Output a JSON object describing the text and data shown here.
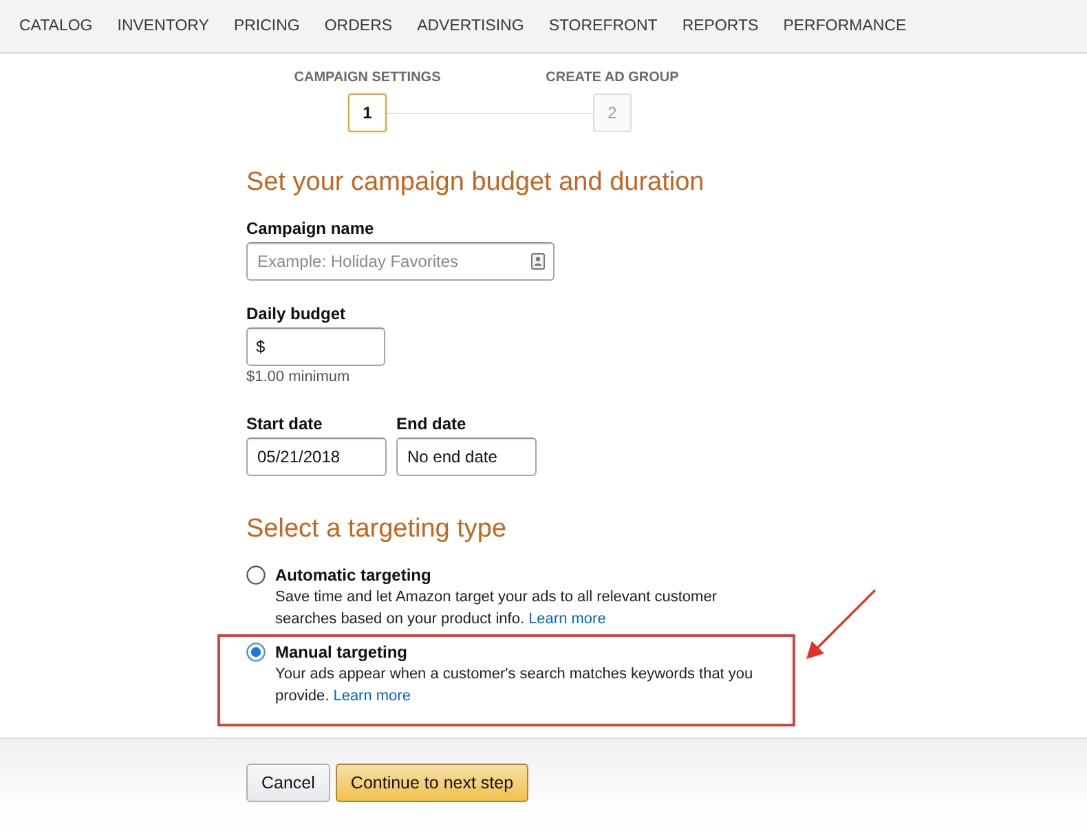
{
  "nav": {
    "items": [
      {
        "label": "CATALOG"
      },
      {
        "label": "INVENTORY"
      },
      {
        "label": "PRICING"
      },
      {
        "label": "ORDERS"
      },
      {
        "label": "ADVERTISING"
      },
      {
        "label": "STOREFRONT"
      },
      {
        "label": "REPORTS"
      },
      {
        "label": "PERFORMANCE"
      }
    ]
  },
  "stepper": {
    "steps": [
      {
        "label": "CAMPAIGN SETTINGS",
        "number": "1",
        "selected": true
      },
      {
        "label": "CREATE AD GROUP",
        "number": "2",
        "selected": false
      }
    ]
  },
  "budget_section": {
    "title": "Set your campaign budget and duration",
    "rows": [
      {
        "fields": [
          {
            "kind": "text",
            "label": "Campaign name",
            "placeholder": "Example: Holiday Favorites"
          }
        ]
      },
      {
        "fields": [
          {
            "kind": "currency",
            "label": "Daily budget",
            "prefix": "$",
            "hint": "$1.00 minimum"
          }
        ]
      },
      {
        "fields": [
          {
            "kind": "date",
            "label": "Start date",
            "value": "05/21/2018"
          },
          {
            "kind": "date",
            "label": "End date",
            "value": "No end date"
          }
        ]
      }
    ]
  },
  "targeting": {
    "title": "Select a targeting type",
    "options": [
      {
        "label": "Automatic targeting",
        "description": "Save time and let Amazon target your ads to all relevant customer searches based on your product info.",
        "link": "Learn more",
        "selected": false,
        "highlighted": false
      },
      {
        "label": "Manual targeting",
        "description": "Your ads appear when a customer's search matches keywords that you provide.",
        "link": "Learn more",
        "selected": true,
        "highlighted": true
      }
    ]
  },
  "footer": {
    "buttons": [
      {
        "label": "Cancel",
        "kind": "secondary"
      },
      {
        "label": "Continue to next step",
        "kind": "primary"
      }
    ]
  }
}
